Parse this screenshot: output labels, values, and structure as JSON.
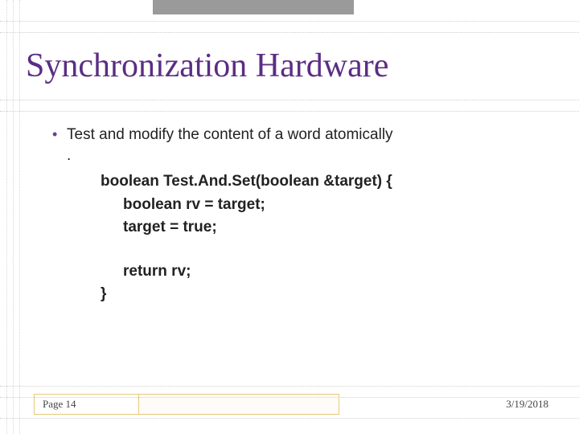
{
  "title": "Synchronization Hardware",
  "bullet": "Test and modify the content of a word atomically",
  "subdot": ".",
  "code": {
    "l1": "boolean Test.And.Set(boolean &target) {",
    "l2": "boolean rv = target;",
    "l3": "target = true;",
    "l4": "return rv;",
    "l5": "}"
  },
  "footer": {
    "page": "Page 14",
    "date": "3/19/2018"
  }
}
